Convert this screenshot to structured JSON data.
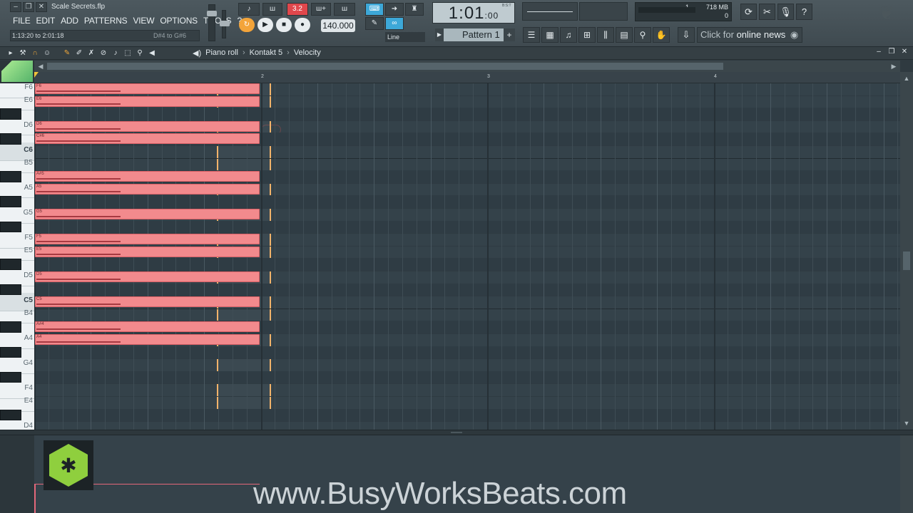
{
  "window": {
    "title": "Scale Secrets.flp",
    "win_min": "–",
    "win_restore": "❐",
    "win_close": "✕"
  },
  "menu": [
    "FILE",
    "EDIT",
    "ADD",
    "PATTERNS",
    "VIEW",
    "OPTIONS",
    "TOOLS",
    "?"
  ],
  "hint_bar": {
    "left": "1:13:20 to 2:01:18",
    "right": "D#4 to G#6"
  },
  "toolbar": {
    "time": "1:01",
    "time_small": ":00",
    "time_unit": "B:S:T",
    "tempo": "140.000",
    "pattern": "Pattern 1",
    "pattern_add": "+",
    "snap_mode": "Line",
    "cpu_top": "1",
    "memory": "718 MB",
    "cpu_bottom": "0",
    "news_prefix": "Click for ",
    "news_bold": "online news",
    "news_icon": "◉"
  },
  "transport_icons": [
    "play-icon",
    "stop-icon",
    "record-icon"
  ],
  "piano_roll": {
    "title": "Piano roll",
    "sep": "›",
    "instrument": "Kontakt 5",
    "target": "Velocity",
    "ruler_numbers": [
      "2",
      "3",
      "4"
    ]
  },
  "keys": [
    {
      "label": "F6",
      "type": "white"
    },
    {
      "label": "E6",
      "type": "white"
    },
    {
      "label": "D6",
      "type": "white"
    },
    {
      "label": "C6",
      "type": "c"
    },
    {
      "label": "B5",
      "type": "white"
    },
    {
      "label": "A5",
      "type": "white"
    },
    {
      "label": "G5",
      "type": "white"
    },
    {
      "label": "F5",
      "type": "white"
    },
    {
      "label": "E5",
      "type": "white"
    },
    {
      "label": "D5",
      "type": "white"
    },
    {
      "label": "C5",
      "type": "c"
    },
    {
      "label": "B4",
      "type": "white"
    },
    {
      "label": "A4",
      "type": "white"
    },
    {
      "label": "G4",
      "type": "white"
    },
    {
      "label": "F4",
      "type": "white"
    },
    {
      "label": "E4",
      "type": "white"
    },
    {
      "label": "D4",
      "type": "white"
    }
  ],
  "notes": [
    "F6",
    "E6",
    "D6",
    "C#6",
    "A#5",
    "A5",
    "G5",
    "F5",
    "E5",
    "D5",
    "C5",
    "A#4",
    "A4"
  ],
  "colors": {
    "note": "#f28a8d",
    "selection": "#f2b36a",
    "accent": "#f3a43a"
  },
  "watermark": "www.BusyWorksBeats.com"
}
